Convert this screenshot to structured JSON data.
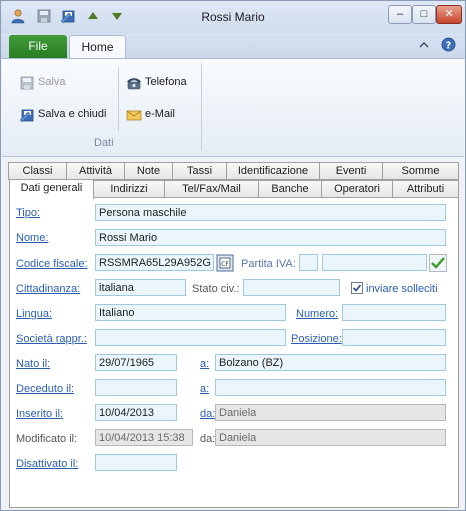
{
  "window": {
    "title": "Rossi Mario"
  },
  "window_controls": {
    "minimize": "–",
    "maximize": "□",
    "close": "✕"
  },
  "ribbon": {
    "tabs": {
      "file": "File",
      "home": "Home"
    },
    "buttons": {
      "save": "Salva",
      "save_close": "Salva e chiudi",
      "phone": "Telefona",
      "email": "e-Mail"
    },
    "group_label": "Dati"
  },
  "tabs_row1": [
    "Classi",
    "Attività",
    "Note",
    "Tassi",
    "Identificazione",
    "Eventi",
    "Somme"
  ],
  "tabs_row2": [
    "Dati generali",
    "Indirizzi",
    "Tel/Fax/Mail",
    "Banche",
    "Operatori",
    "Attributi"
  ],
  "form": {
    "tipo": {
      "label": "Tipo:",
      "value": "Persona maschile"
    },
    "nome": {
      "label": "Nome:",
      "value": "Rossi Mario"
    },
    "codice_fiscale": {
      "label": "Codice fiscale:",
      "value": "RSSMRA65L29A952G"
    },
    "partita_iva": {
      "label": "Partita IVA:",
      "value": "",
      "value2": ""
    },
    "cittadinanza": {
      "label": "Cittadinanza:",
      "value": "italiana"
    },
    "stato_civ": {
      "label": "Stato civ.:",
      "value": ""
    },
    "inviare_solleciti": {
      "label": "inviare solleciti",
      "checked": true
    },
    "lingua": {
      "label": "Lingua:",
      "value": "Italiano"
    },
    "numero": {
      "label": "Numero:",
      "value": ""
    },
    "societa": {
      "label": "Società rappr.:",
      "value": ""
    },
    "posizione": {
      "label": "Posizione:",
      "value": ""
    },
    "nato": {
      "label": "Nato il:",
      "value": "29/07/1965",
      "a_label": "a:",
      "a_value": "Bolzano (BZ)"
    },
    "deceduto": {
      "label": "Deceduto il:",
      "value": "",
      "a_label": "a:",
      "a_value": ""
    },
    "inserito": {
      "label": "Inserito il:",
      "value": "10/04/2013",
      "da_label": "da:",
      "da_value": "Daniela"
    },
    "modificato": {
      "label": "Modificato il:",
      "value": "10/04/2013 15:38",
      "da_label": "da:",
      "da_value": "Daniela"
    },
    "disattivato": {
      "label": "Disattivato il:",
      "value": ""
    }
  },
  "colors": {
    "file_tab": "#2a7d24",
    "field_bg": "#eaf6fb",
    "field_border": "#9fc9dd",
    "link_label": "#2a5db0"
  }
}
